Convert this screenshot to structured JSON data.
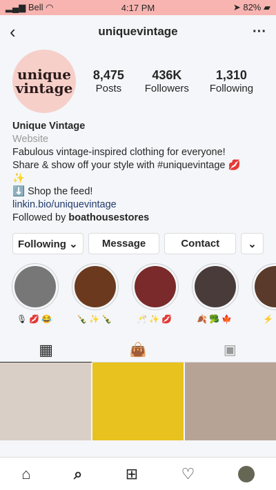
{
  "status": {
    "carrier": "Bell",
    "time": "4:17 PM",
    "battery": "82%"
  },
  "nav": {
    "title": "uniquevintage",
    "back_icon": "chevron-left",
    "more_icon": "ellipsis"
  },
  "profile": {
    "logo_line1": "unique",
    "logo_line2": "vintage",
    "stats": [
      {
        "value": "8,475",
        "label": "Posts"
      },
      {
        "value": "436K",
        "label": "Followers"
      },
      {
        "value": "1,310",
        "label": "Following"
      }
    ]
  },
  "bio": {
    "name": "Unique Vintage",
    "category": "Website",
    "line1": "Fabulous vintage-inspired clothing for everyone!",
    "line2": "Share & show off your style with #uniquevintage 💋",
    "line3": "✨",
    "line4": "⬇️ Shop the feed!",
    "link": "linkin.bio/uniquevintage",
    "followed_prefix": "Followed by ",
    "followed_user": "boathousestores"
  },
  "buttons": {
    "following": "Following ⌄",
    "message": "Message",
    "contact": "Contact",
    "more": "⌄"
  },
  "stories": [
    {
      "emoji": "🎙💋😂",
      "color": "#555"
    },
    {
      "emoji": "🍾✨🍾",
      "color": "#6b3a1e"
    },
    {
      "emoji": "🥂✨💋",
      "color": "#7a2a2a"
    },
    {
      "emoji": "🍂🥦🍁",
      "color": "#4a3b3b"
    },
    {
      "emoji": "⚡✨",
      "color": "#5a3a2a"
    }
  ],
  "tabs": [
    "grid",
    "shop",
    "tagged"
  ],
  "colors": {
    "status_bar": "#f7b4b0",
    "link": "#223a6b"
  }
}
